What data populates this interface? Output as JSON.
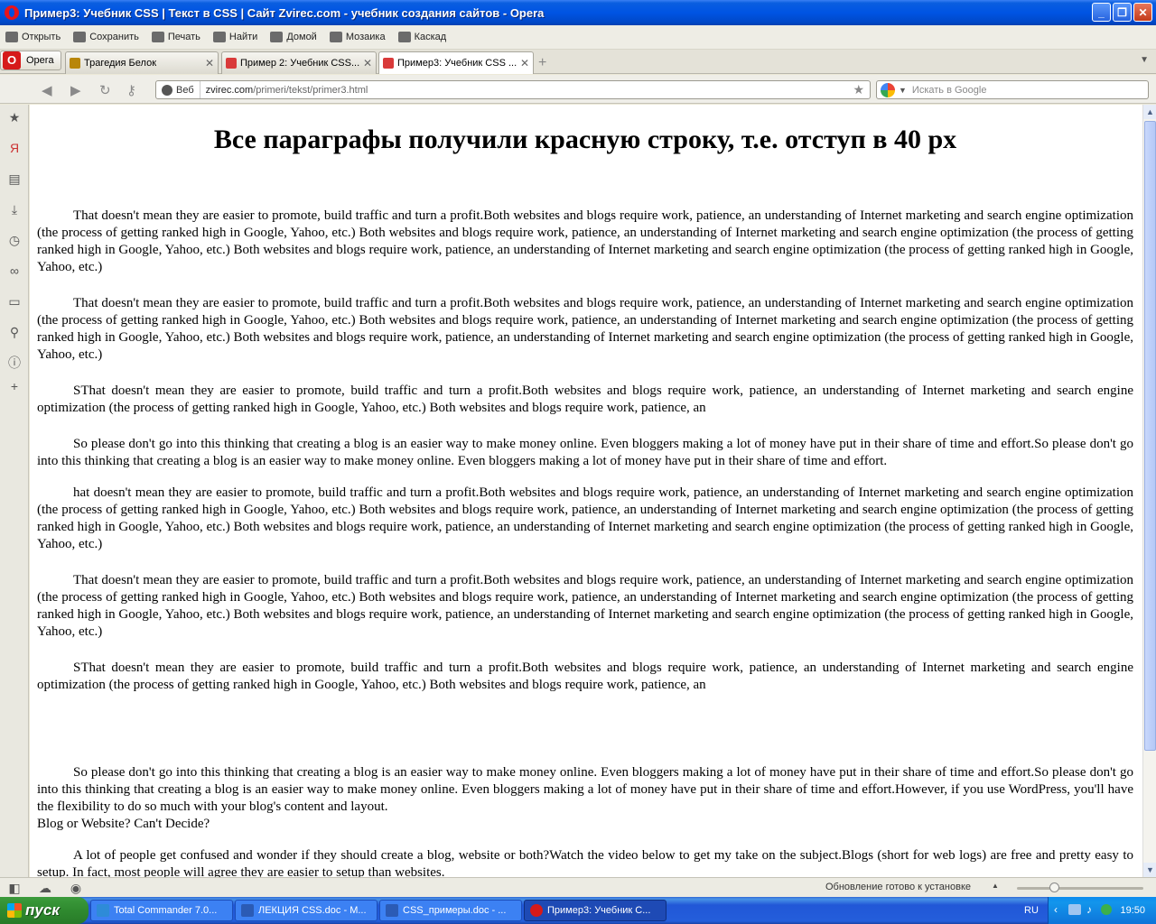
{
  "window": {
    "title": "Пример3: Учебник CSS | Текст в CSS | Сайт Zvirec.com - учебник создания сайтов - Opera",
    "buttons": [
      "_",
      "❐",
      "✕"
    ]
  },
  "toolbar": {
    "items": [
      {
        "label": "Открыть",
        "icon": "folder-icon"
      },
      {
        "label": "Сохранить",
        "icon": "save-icon"
      },
      {
        "label": "Печать",
        "icon": "print-icon"
      },
      {
        "label": "Найти",
        "icon": "find-icon"
      },
      {
        "label": "Домой",
        "icon": "home-icon"
      },
      {
        "label": "Мозаика",
        "icon": "tile-icon"
      },
      {
        "label": "Каскад",
        "icon": "cascade-icon"
      }
    ]
  },
  "tabs": {
    "opera_menu": "Opera",
    "items": [
      {
        "label": "Трагедия Белок",
        "active": false,
        "color": "#B8860B"
      },
      {
        "label": "Пример 2: Учебник CSS...",
        "active": false,
        "color": "#D93A3A"
      },
      {
        "label": "Пример3: Учебник CSS ...",
        "active": true,
        "color": "#D93A3A"
      }
    ]
  },
  "address": {
    "mode_label": "Веб",
    "url_host": "zvirec.com",
    "url_path": "/primeri/tekst/primer3.html",
    "search_placeholder": "Искать в Google"
  },
  "page": {
    "heading": "Все параграфы получили красную строку, т.е. отступ в 40 px",
    "paragraphs": [
      "That doesn't mean they are easier to promote, build traffic and turn a profit.Both websites and blogs require work, patience, an understanding of Internet marketing and search engine optimization (the process of getting ranked high in Google, Yahoo, etc.) Both websites and blogs require work, patience, an understanding of Internet marketing and search engine optimization (the process of getting ranked high in Google, Yahoo, etc.) Both websites and blogs require work, patience, an understanding of Internet marketing and search engine optimization (the process of getting ranked high in Google, Yahoo, etc.)",
      "That doesn't mean they are easier to promote, build traffic and turn a profit.Both websites and blogs require work, patience, an understanding of Internet marketing and search engine optimization (the process of getting ranked high in Google, Yahoo, etc.) Both websites and blogs require work, patience, an understanding of Internet marketing and search engine optimization (the process of getting ranked high in Google, Yahoo, etc.) Both websites and blogs require work, patience, an understanding of Internet marketing and search engine optimization (the process of getting ranked high in Google, Yahoo, etc.)",
      "SThat doesn't mean they are easier to promote, build traffic and turn a profit.Both websites and blogs require work, patience, an understanding of Internet marketing and search engine optimization (the process of getting ranked high in Google, Yahoo, etc.) Both websites and blogs require work, patience, an",
      "So please don't go into this thinking that creating a blog is an easier way to make money online. Even bloggers making a lot of money have put in their share of time and effort.So please don't go into this thinking that creating a blog is an easier way to make money online. Even bloggers making a lot of money have put in their share of time and effort.",
      "hat doesn't mean they are easier to promote, build traffic and turn a profit.Both websites and blogs require work, patience, an understanding of Internet marketing and search engine optimization (the process of getting ranked high in Google, Yahoo, etc.) Both websites and blogs require work, patience, an understanding of Internet marketing and search engine optimization (the process of getting ranked high in Google, Yahoo, etc.) Both websites and blogs require work, patience, an understanding of Internet marketing and search engine optimization (the process of getting ranked high in Google, Yahoo, etc.)",
      "That doesn't mean they are easier to promote, build traffic and turn a profit.Both websites and blogs require work, patience, an understanding of Internet marketing and search engine optimization (the process of getting ranked high in Google, Yahoo, etc.) Both websites and blogs require work, patience, an understanding of Internet marketing and search engine optimization (the process of getting ranked high in Google, Yahoo, etc.) Both websites and blogs require work, patience, an understanding of Internet marketing and search engine optimization (the process of getting ranked high in Google, Yahoo, etc.)",
      "SThat doesn't mean they are easier to promote, build traffic and turn a profit.Both websites and blogs require work, patience, an understanding of Internet marketing and search engine optimization (the process of getting ranked high in Google, Yahoo, etc.) Both websites and blogs require work, patience, an",
      "So please don't go into this thinking that creating a blog is an easier way to make money online. Even bloggers making a lot of money have put in their share of time and effort.So please don't go into this thinking that creating a blog is an easier way to make money online. Even bloggers making a lot of money have put in their share of time and effort.However, if you use WordPress, you'll have the flexibility to do so much with your blog's content and layout.",
      "A lot of people get confused and wonder if they should create a blog, website or both?Watch the video below to get my take on the subject.Blogs (short for web logs) are free and pretty easy to setup. In fact, most people will agree they are easier to setup than websites."
    ],
    "plain_line": "Blog or Website? Can't Decide?"
  },
  "status": {
    "text": "Обновление готово к установке",
    "zoom_level": 0.3
  },
  "taskbar": {
    "start_label": "пуск",
    "tasks": [
      {
        "label": "Total Commander 7.0...",
        "active": false,
        "color": "#2E8BD8"
      },
      {
        "label": "ЛЕКЦИЯ CSS.doc - M...",
        "active": false,
        "color": "#2B5BB5"
      },
      {
        "label": "CSS_примеры.doc - ...",
        "active": false,
        "color": "#2B5BB5"
      },
      {
        "label": "Пример3: Учебник С...",
        "active": true,
        "color": "#D61A1A"
      }
    ],
    "lang": "RU",
    "clock": "19:50"
  }
}
